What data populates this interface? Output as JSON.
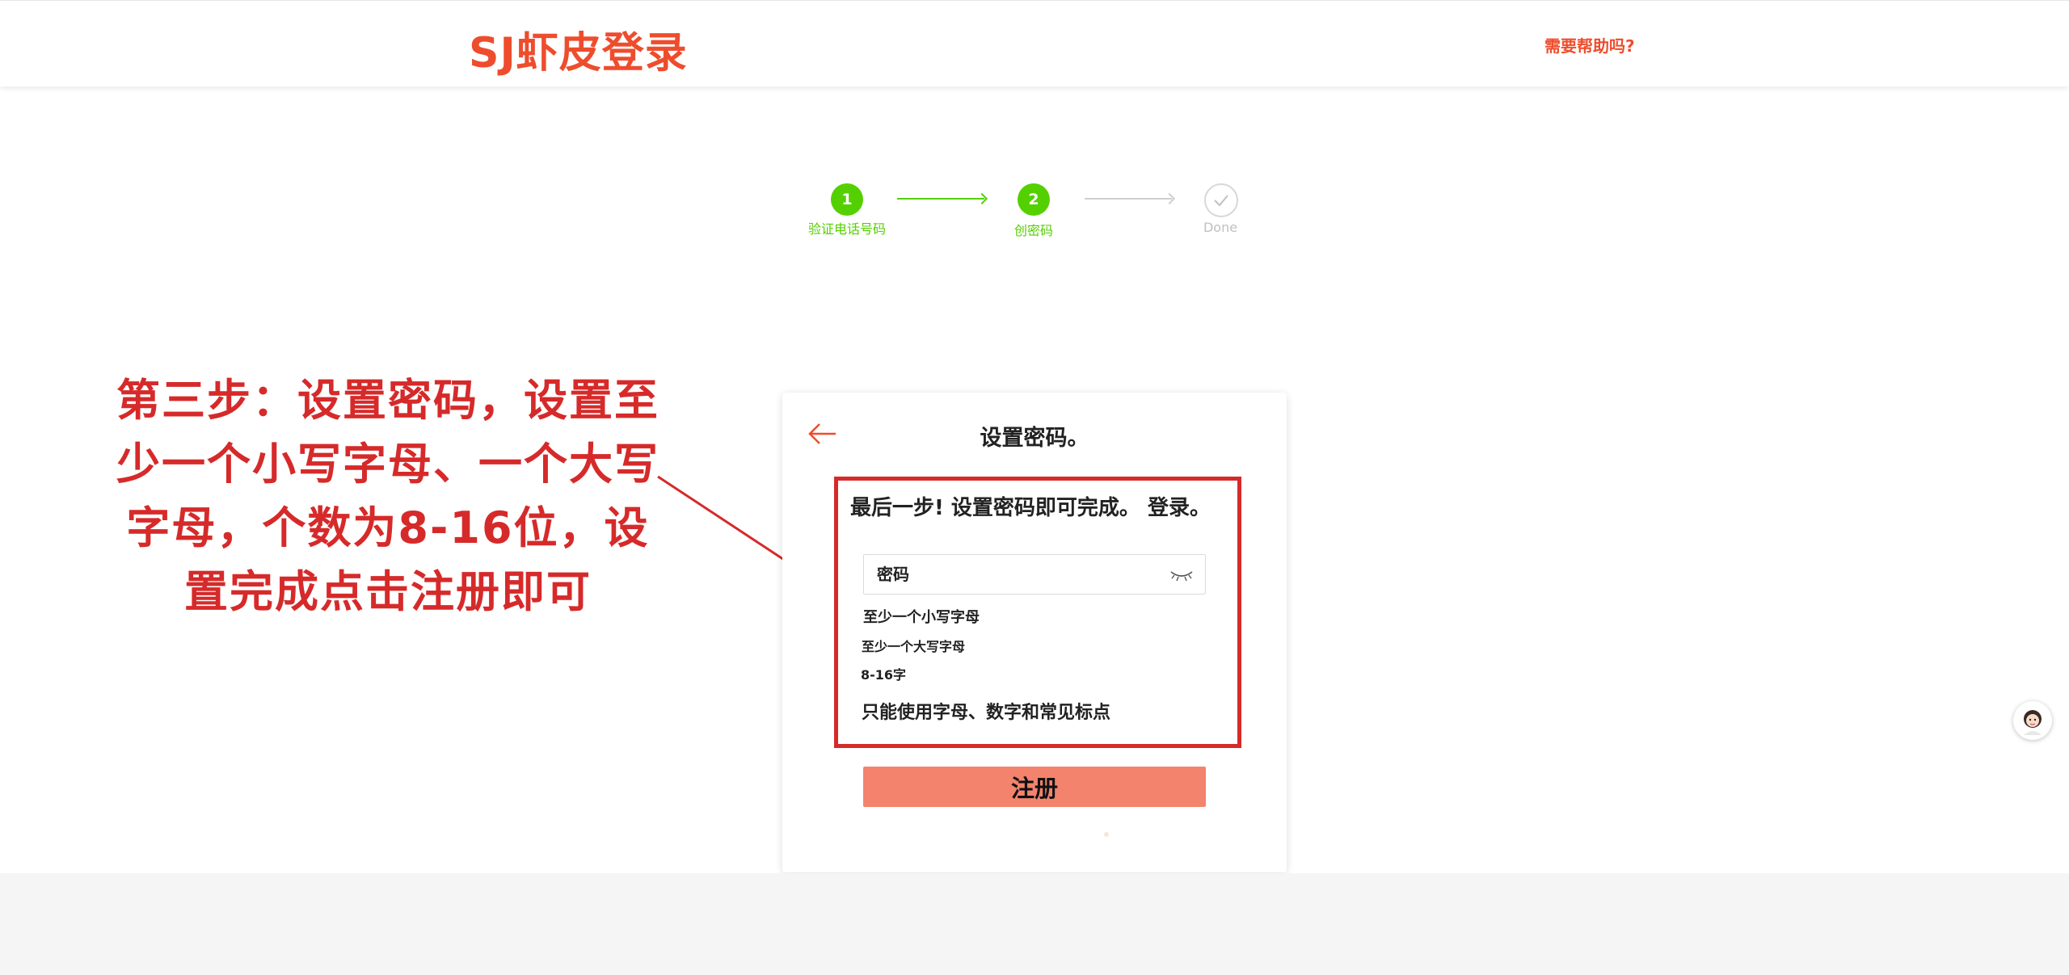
{
  "header": {
    "brand": "SJ虾皮登录",
    "help_link": "需要帮助吗?"
  },
  "stepper": {
    "steps": [
      {
        "number": "1",
        "label": "验证电话号码",
        "state": "done"
      },
      {
        "number": "2",
        "label": "创密码",
        "state": "current"
      },
      {
        "number": "",
        "label": "Done",
        "state": "pending"
      }
    ],
    "active_color": "#54d000",
    "pending_color": "#cfcfcf"
  },
  "annotation": {
    "text": "第三步：设置密码，设置至少一个小写字母、一个大写字母，个数为8-16位，设置完成点击注册即可",
    "color": "#d62a2a"
  },
  "card": {
    "title": "设置密码。",
    "subtitle": "最后一步! 设置密码即可完成。 登录。",
    "password_placeholder": "密码",
    "rules": [
      "至少一个小写字母",
      "至少一个大写字母",
      "8-16字",
      "只能使用字母、数字和常见标点"
    ],
    "submit_label": "注册",
    "accent_color": "#ee4d2d",
    "button_color": "#f3836d"
  },
  "icons": {
    "back": "arrow-left-icon",
    "eye": "eye-closed-icon",
    "check": "check-icon",
    "avatar": "assistant-avatar-icon"
  }
}
